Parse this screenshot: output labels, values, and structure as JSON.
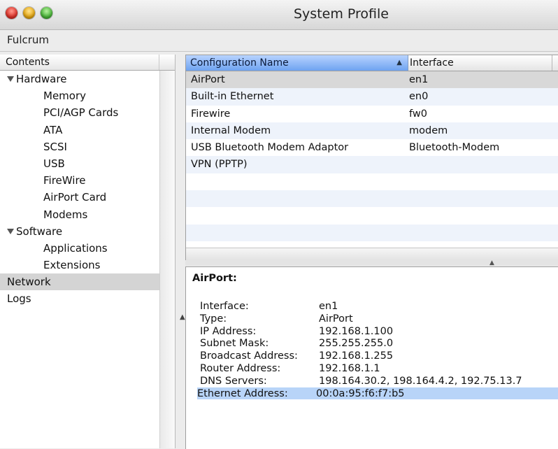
{
  "window": {
    "title": "System Profile"
  },
  "app": {
    "name": "Fulcrum"
  },
  "sidebar": {
    "header": "Contents",
    "items": [
      {
        "label": "Hardware",
        "level": 0,
        "expanded": true
      },
      {
        "label": "Memory",
        "level": 1
      },
      {
        "label": "PCI/AGP Cards",
        "level": 1
      },
      {
        "label": "ATA",
        "level": 1
      },
      {
        "label": "SCSI",
        "level": 1
      },
      {
        "label": "USB",
        "level": 1
      },
      {
        "label": "FireWire",
        "level": 1
      },
      {
        "label": "AirPort Card",
        "level": 1
      },
      {
        "label": "Modems",
        "level": 1
      },
      {
        "label": "Software",
        "level": 0,
        "expanded": true
      },
      {
        "label": "Applications",
        "level": 1
      },
      {
        "label": "Extensions",
        "level": 1
      },
      {
        "label": "Network",
        "level": 2,
        "selected": true
      },
      {
        "label": "Logs",
        "level": 2
      }
    ]
  },
  "table": {
    "columns": [
      "Configuration Name",
      "Interface"
    ],
    "sort_indicator": "▲",
    "rows": [
      [
        "AirPort",
        "en1"
      ],
      [
        "Built-in Ethernet",
        "en0"
      ],
      [
        "Firewire",
        "fw0"
      ],
      [
        "Internal Modem",
        "modem"
      ],
      [
        "USB Bluetooth Modem Adaptor",
        "Bluetooth-Modem"
      ],
      [
        "VPN (PPTP)",
        ""
      ]
    ],
    "selected_row": 0
  },
  "details": {
    "title": "AirPort:",
    "fields": [
      [
        "Interface:",
        "en1"
      ],
      [
        "Type:",
        "AirPort"
      ],
      [
        "IP Address:",
        "192.168.1.100"
      ],
      [
        "Subnet Mask:",
        "255.255.255.0"
      ],
      [
        "Broadcast Address:",
        "192.168.1.255"
      ],
      [
        "Router Address:",
        "192.168.1.1"
      ],
      [
        "DNS Servers:",
        "198.164.30.2, 198.164.4.2, 192.75.13.7"
      ],
      [
        "Ethernet Address:",
        "00:0a:95:f6:f7:b5"
      ]
    ],
    "highlighted_field": 7
  },
  "colors": {
    "accent": "#6ea3f0",
    "selection": "#d4d4d4",
    "highlight": "#b8d4f8"
  }
}
